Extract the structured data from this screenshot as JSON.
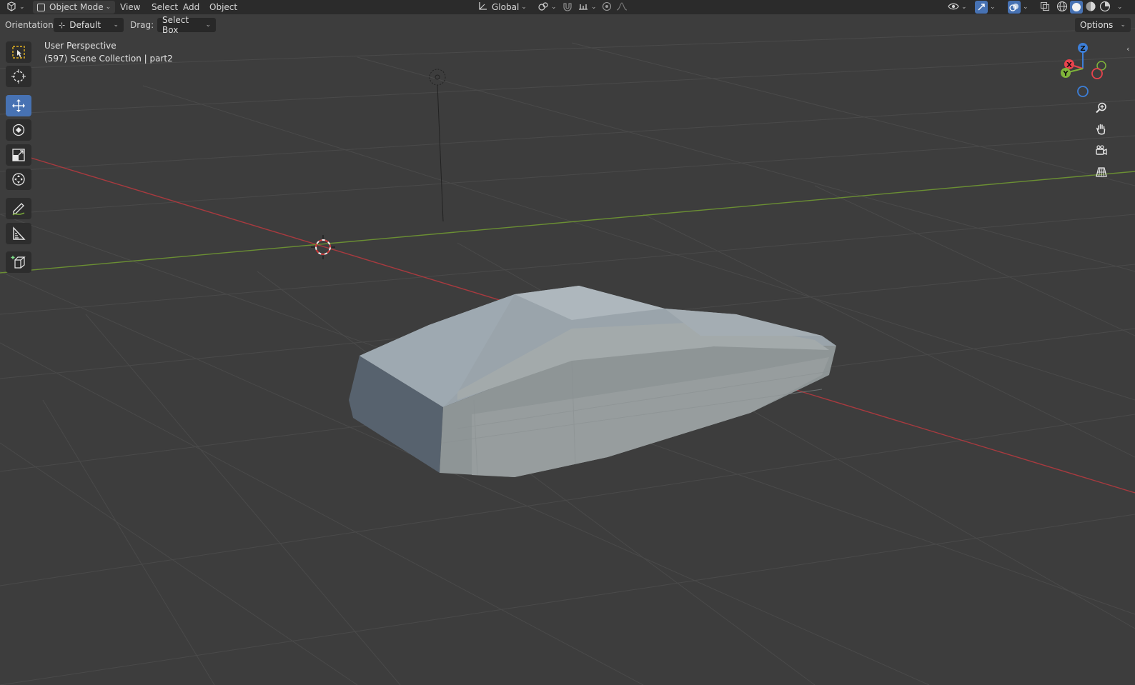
{
  "header": {
    "mode_label": "Object Mode",
    "menus": [
      "View",
      "Select",
      "Add",
      "Object"
    ],
    "transform_orientation": "Global",
    "options_label": "Options"
  },
  "tool_options": {
    "orientation_label": "Orientation:",
    "orientation_value": "Default",
    "drag_label": "Drag:",
    "drag_value": "Select Box"
  },
  "viewport": {
    "perspective_label": "User Perspective",
    "collection_label": "(597) Scene Collection | part2"
  },
  "gizmo": {
    "axes": [
      "Z",
      "X",
      "Y"
    ]
  },
  "icons": {
    "editor_type": "cube-editor-icon",
    "mode": "object-mode-icon",
    "orientation": "axes-icon",
    "pivot": "pivot-icon",
    "snap": "magnet-icon",
    "proportional": "proportional-icon",
    "visibility": "eye-icon",
    "gizmo_toggle": "gizmo-icon",
    "overlay": "overlay-icon"
  },
  "colors": {
    "accent": "#4772b3",
    "x_axis": "#e8434d",
    "y_axis": "#7fb43a",
    "z_axis": "#3d7fd8",
    "header_bg": "#2b2b2b",
    "viewport_bg": "#3d3d3d"
  }
}
